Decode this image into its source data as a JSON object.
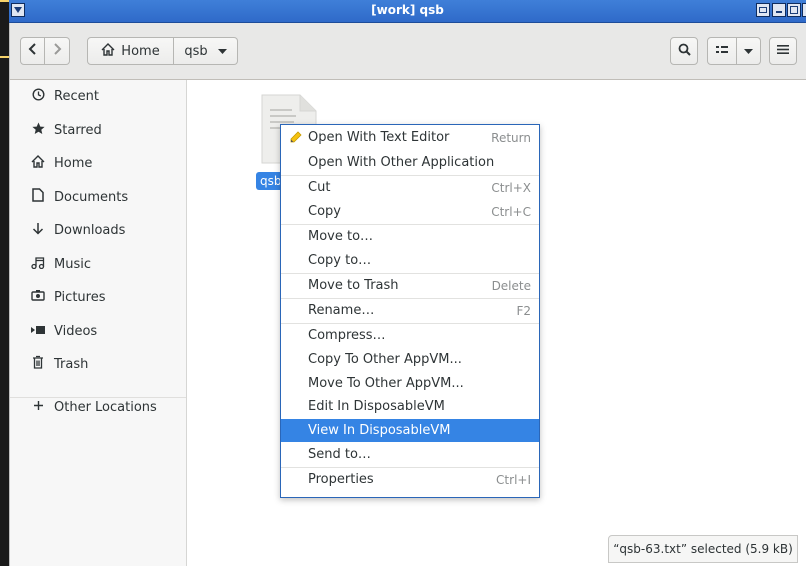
{
  "window": {
    "title": "[work] qsb"
  },
  "toolbar": {
    "back_icon": "chevron-left-icon",
    "forward_icon": "chevron-right-icon",
    "path": [
      {
        "label": "Home",
        "icon": "home-icon"
      },
      {
        "label": "qsb"
      }
    ],
    "search_icon": "search-icon",
    "view_icon": "list-view-icon",
    "view_menu_icon": "chevron-down-icon",
    "menu_icon": "hamburger-icon"
  },
  "sidebar": {
    "items": [
      {
        "label": "Recent",
        "icon": "clock-icon"
      },
      {
        "label": "Starred",
        "icon": "star-icon"
      },
      {
        "label": "Home",
        "icon": "home-icon"
      },
      {
        "label": "Documents",
        "icon": "document-icon"
      },
      {
        "label": "Downloads",
        "icon": "download-arrow-icon"
      },
      {
        "label": "Music",
        "icon": "music-note-icon"
      },
      {
        "label": "Pictures",
        "icon": "camera-icon"
      },
      {
        "label": "Videos",
        "icon": "video-icon"
      },
      {
        "label": "Trash",
        "icon": "trash-icon"
      }
    ],
    "other_locations": {
      "label": "Other Locations",
      "icon": "plus-icon"
    }
  },
  "file": {
    "name": "qsb"
  },
  "context_menu": {
    "items": [
      {
        "label": "Open With Text Editor",
        "shortcut": "Return",
        "icon": "text-editor-icon"
      },
      {
        "label": "Open With Other Application",
        "shortcut": ""
      },
      {
        "label": "Cut",
        "shortcut": "Ctrl+X"
      },
      {
        "label": "Copy",
        "shortcut": "Ctrl+C"
      },
      {
        "label": "Move to…",
        "shortcut": ""
      },
      {
        "label": "Copy to…",
        "shortcut": ""
      },
      {
        "label": "Move to Trash",
        "shortcut": "Delete"
      },
      {
        "label": "Rename…",
        "shortcut": "F2"
      },
      {
        "label": "Compress…",
        "shortcut": ""
      },
      {
        "label": "Copy To Other AppVM...",
        "shortcut": ""
      },
      {
        "label": "Move To Other AppVM...",
        "shortcut": ""
      },
      {
        "label": "Edit In DisposableVM",
        "shortcut": ""
      },
      {
        "label": "View In DisposableVM",
        "shortcut": "",
        "selected": true
      },
      {
        "label": "Send to…",
        "shortcut": ""
      },
      {
        "label": "Properties",
        "shortcut": "Ctrl+I"
      }
    ]
  },
  "status": {
    "text": "“qsb-63.txt” selected  (5.9 kB)"
  },
  "colors": {
    "accent": "#3584e4",
    "titlebar": "#2f6ac9",
    "menu_border": "#2a66b8"
  }
}
